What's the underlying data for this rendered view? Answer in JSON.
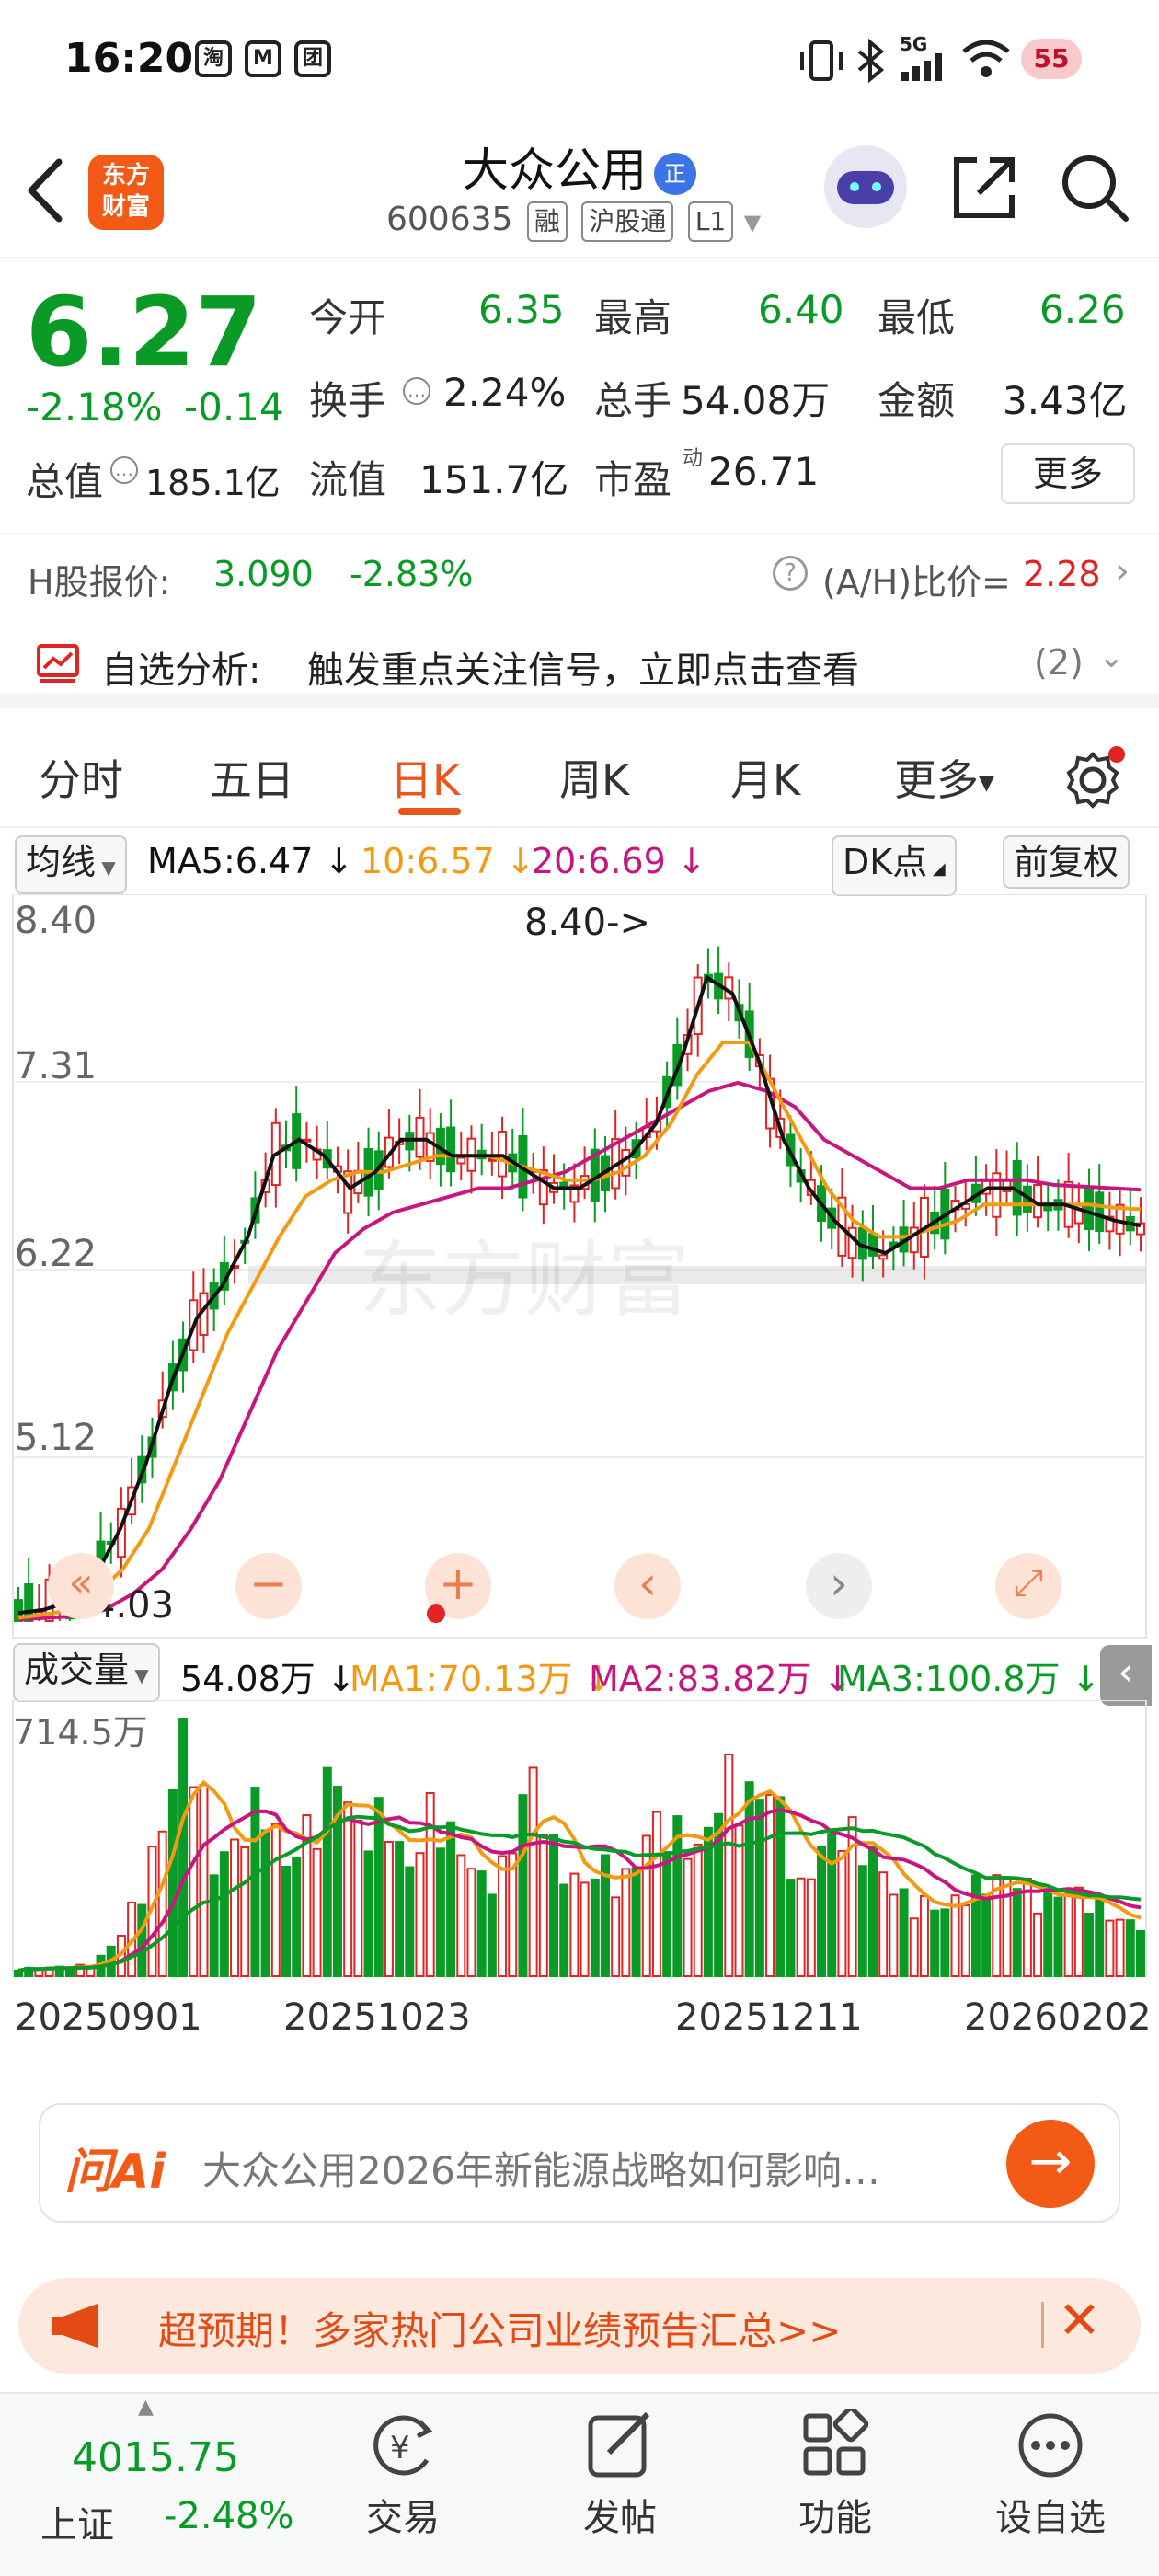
{
  "status_bar": {
    "time": "16:20",
    "apps": [
      "淘",
      "M",
      "团"
    ],
    "network": "5G",
    "battery": "55"
  },
  "header": {
    "logo_line1": "东方",
    "logo_line2": "财富",
    "stock_name": "大众公用",
    "badge": "正",
    "code": "600635",
    "tags": [
      "融",
      "沪股通",
      "L1"
    ]
  },
  "quote": {
    "price": "6.27",
    "change_pct": "-2.18%",
    "change": "-0.14",
    "open_label": "今开",
    "open": "6.35",
    "high_label": "最高",
    "high": "6.40",
    "low_label": "最低",
    "low": "6.26",
    "turnover_label": "换手",
    "turnover": "2.24%",
    "volume_label": "总手",
    "volume": "54.08万",
    "amount_label": "金额",
    "amount": "3.43亿",
    "mktcap_label": "总值",
    "mktcap": "185.1亿",
    "float_label": "流值",
    "float_cap": "151.7亿",
    "pe_label": "市盈",
    "pe_sup": "动",
    "pe": "26.71",
    "more_button": "更多"
  },
  "hk": {
    "label": "H股报价:",
    "price": "3.090",
    "change": "-2.83%",
    "ratio_label": "(A/H)比价=",
    "ratio": "2.28"
  },
  "signal": {
    "label": "自选分析:",
    "text": "触发重点关注信号，立即点击查看",
    "count": "(2)"
  },
  "tabs": [
    "分时",
    "五日",
    "日K",
    "周K",
    "月K",
    "更多"
  ],
  "active_tab": "日K",
  "ma_row": {
    "selector": "均线",
    "ma5": "MA5:6.47 ↓",
    "ma10": "10:6.57 ↓",
    "ma20": "20:6.69 ↓",
    "dk": "DK点",
    "adjust": "前复权"
  },
  "colors": {
    "up": "#e02424",
    "down": "#0a9b27",
    "ma5": "#111111",
    "ma10": "#f29a12",
    "ma20": "#c8167e",
    "accent": "#e8561c"
  },
  "chart_data": [
    {
      "type": "candlestick",
      "y_ticks": [
        "8.40",
        "7.31",
        "6.22",
        "5.12",
        "4.03"
      ],
      "ylim": [
        4.03,
        8.4
      ],
      "annotations": [
        "8.40->",
        "4.03"
      ],
      "watermark": "东方财富",
      "ma5": [
        4.08,
        4.1,
        4.15,
        4.3,
        4.6,
        5.0,
        5.5,
        5.9,
        6.1,
        6.4,
        6.9,
        7.0,
        6.9,
        6.7,
        6.8,
        7.0,
        7.0,
        6.9,
        6.9,
        6.9,
        6.8,
        6.7,
        6.7,
        6.8,
        6.9,
        7.1,
        7.5,
        8.0,
        7.9,
        7.5,
        7.0,
        6.7,
        6.5,
        6.35,
        6.3,
        6.4,
        6.5,
        6.6,
        6.7,
        6.7,
        6.6,
        6.6,
        6.55,
        6.5,
        6.47
      ],
      "ma10": [
        4.05,
        4.07,
        4.1,
        4.2,
        4.35,
        4.6,
        5.0,
        5.4,
        5.8,
        6.1,
        6.4,
        6.65,
        6.75,
        6.8,
        6.8,
        6.85,
        6.9,
        6.9,
        6.9,
        6.85,
        6.8,
        6.75,
        6.75,
        6.8,
        6.9,
        7.1,
        7.4,
        7.6,
        7.6,
        7.3,
        7.0,
        6.7,
        6.5,
        6.4,
        6.4,
        6.45,
        6.5,
        6.6,
        6.6,
        6.6,
        6.6,
        6.6,
        6.58,
        6.57
      ],
      "ma20": [
        4.04,
        4.05,
        4.06,
        4.1,
        4.2,
        4.35,
        4.6,
        4.9,
        5.3,
        5.7,
        6.0,
        6.3,
        6.45,
        6.55,
        6.6,
        6.65,
        6.7,
        6.7,
        6.75,
        6.8,
        6.9,
        7.0,
        7.1,
        7.2,
        7.3,
        7.35,
        7.3,
        7.2,
        7.0,
        6.9,
        6.8,
        6.7,
        6.7,
        6.75,
        6.75,
        6.75,
        6.72,
        6.71,
        6.7,
        6.69
      ]
    },
    {
      "type": "bar",
      "title": "成交量",
      "y_ticks": [
        "714.5万"
      ],
      "x_ticks": [
        "20250901",
        "20251023",
        "20251211",
        "20260202"
      ],
      "values": [
        20,
        22,
        25,
        30,
        90,
        230,
        420,
        714,
        300,
        360,
        500,
        290,
        420,
        560,
        380,
        450,
        280,
        470,
        350,
        260,
        300,
        560,
        330,
        240,
        300,
        260,
        420,
        390,
        330,
        550,
        480,
        510,
        230,
        350,
        400,
        330,
        220,
        200,
        180,
        240,
        260,
        260,
        200,
        230,
        210,
        150,
        140
      ],
      "labels_row": {
        "selector": "成交量",
        "vol": "54.08万 ↓",
        "ma1": "MA1:70.13万 ↓",
        "ma2": "MA2:83.82万 ↓",
        "ma3": "MA3:100.8万 ↓"
      }
    }
  ],
  "ai_bar": {
    "brand": "问Ai",
    "prompt": "大众公用2026年新能源战略如何影响…"
  },
  "notice": {
    "text": "超预期！多家热门公司业绩预告汇总>>"
  },
  "bottom_nav": {
    "index_value": "4015.75",
    "index_name": "上证",
    "index_change": "-2.48%",
    "items": [
      "交易",
      "发帖",
      "功能",
      "设自选"
    ]
  }
}
